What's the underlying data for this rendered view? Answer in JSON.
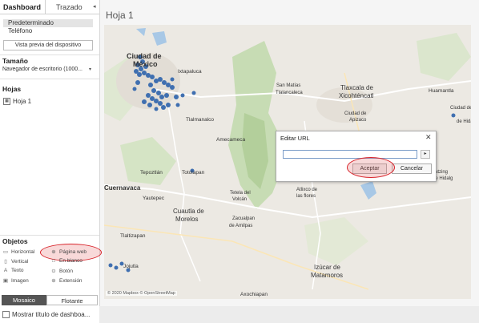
{
  "panel": {
    "tabs": [
      "Dashboard",
      "Trazado"
    ],
    "devices": [
      "Predeterminado",
      "Teléfono"
    ],
    "preview_button": "Vista previa del dispositivo",
    "size_header": "Tamaño",
    "size_value": "Navegador de escritorio (1000...",
    "sheets_header": "Hojas",
    "sheet_item": "Hoja 1",
    "objects_header": "Objetos",
    "objects": [
      {
        "icon": "horizontal-icon",
        "label": "Horizontal"
      },
      {
        "icon": "web-page-icon",
        "label": "Página web"
      },
      {
        "icon": "vertical-icon",
        "label": "Vertical"
      },
      {
        "icon": "blank-icon",
        "label": "En blanco"
      },
      {
        "icon": "text-icon",
        "label": "Texto"
      },
      {
        "icon": "button-icon",
        "label": "Botón"
      },
      {
        "icon": "image-icon",
        "label": "Imagen"
      },
      {
        "icon": "extension-icon",
        "label": "Extensión"
      }
    ],
    "layout_options": [
      "Mosaico",
      "Flotante"
    ],
    "show_title": "Mostrar título de dashboa..."
  },
  "sheet_title": "Hoja 1",
  "map": {
    "attribution": "© 2020 Mapbox © OpenStreetMap",
    "labels": [
      "Ciudad de\nMéxico",
      "Ixtapaluca",
      "San Matías\nTlalancaleca",
      "Tlaxcala de\nXicohténcatl",
      "Huamantla",
      "Ciudad de\nApizaco",
      "Tlalmanalco",
      "Amecameca",
      "Ciudad de\nRafael\nde Hidalgo",
      "Tepoztlán",
      "Totolapan",
      "Cuernavaca",
      "Yautepec",
      "Tetela del\nVolcán",
      "Atlixco de\nlas flores",
      "Acatzing\nde Hidalg",
      "Cuautla de\nMorelos",
      "Zacualpan\nde Amilpas",
      "Tlaltizapan",
      "Jojutla",
      "Izúcar de\nMatamoros",
      "Axochiapan"
    ]
  },
  "dialog": {
    "title": "Editar URL",
    "input_value": "",
    "ok_label": "Aceptar",
    "cancel_label": "Cancelar"
  },
  "colors": {
    "accent_red": "#d8232a",
    "point_blue": "#3f6fb0",
    "mosaic_dark": "#555555"
  }
}
